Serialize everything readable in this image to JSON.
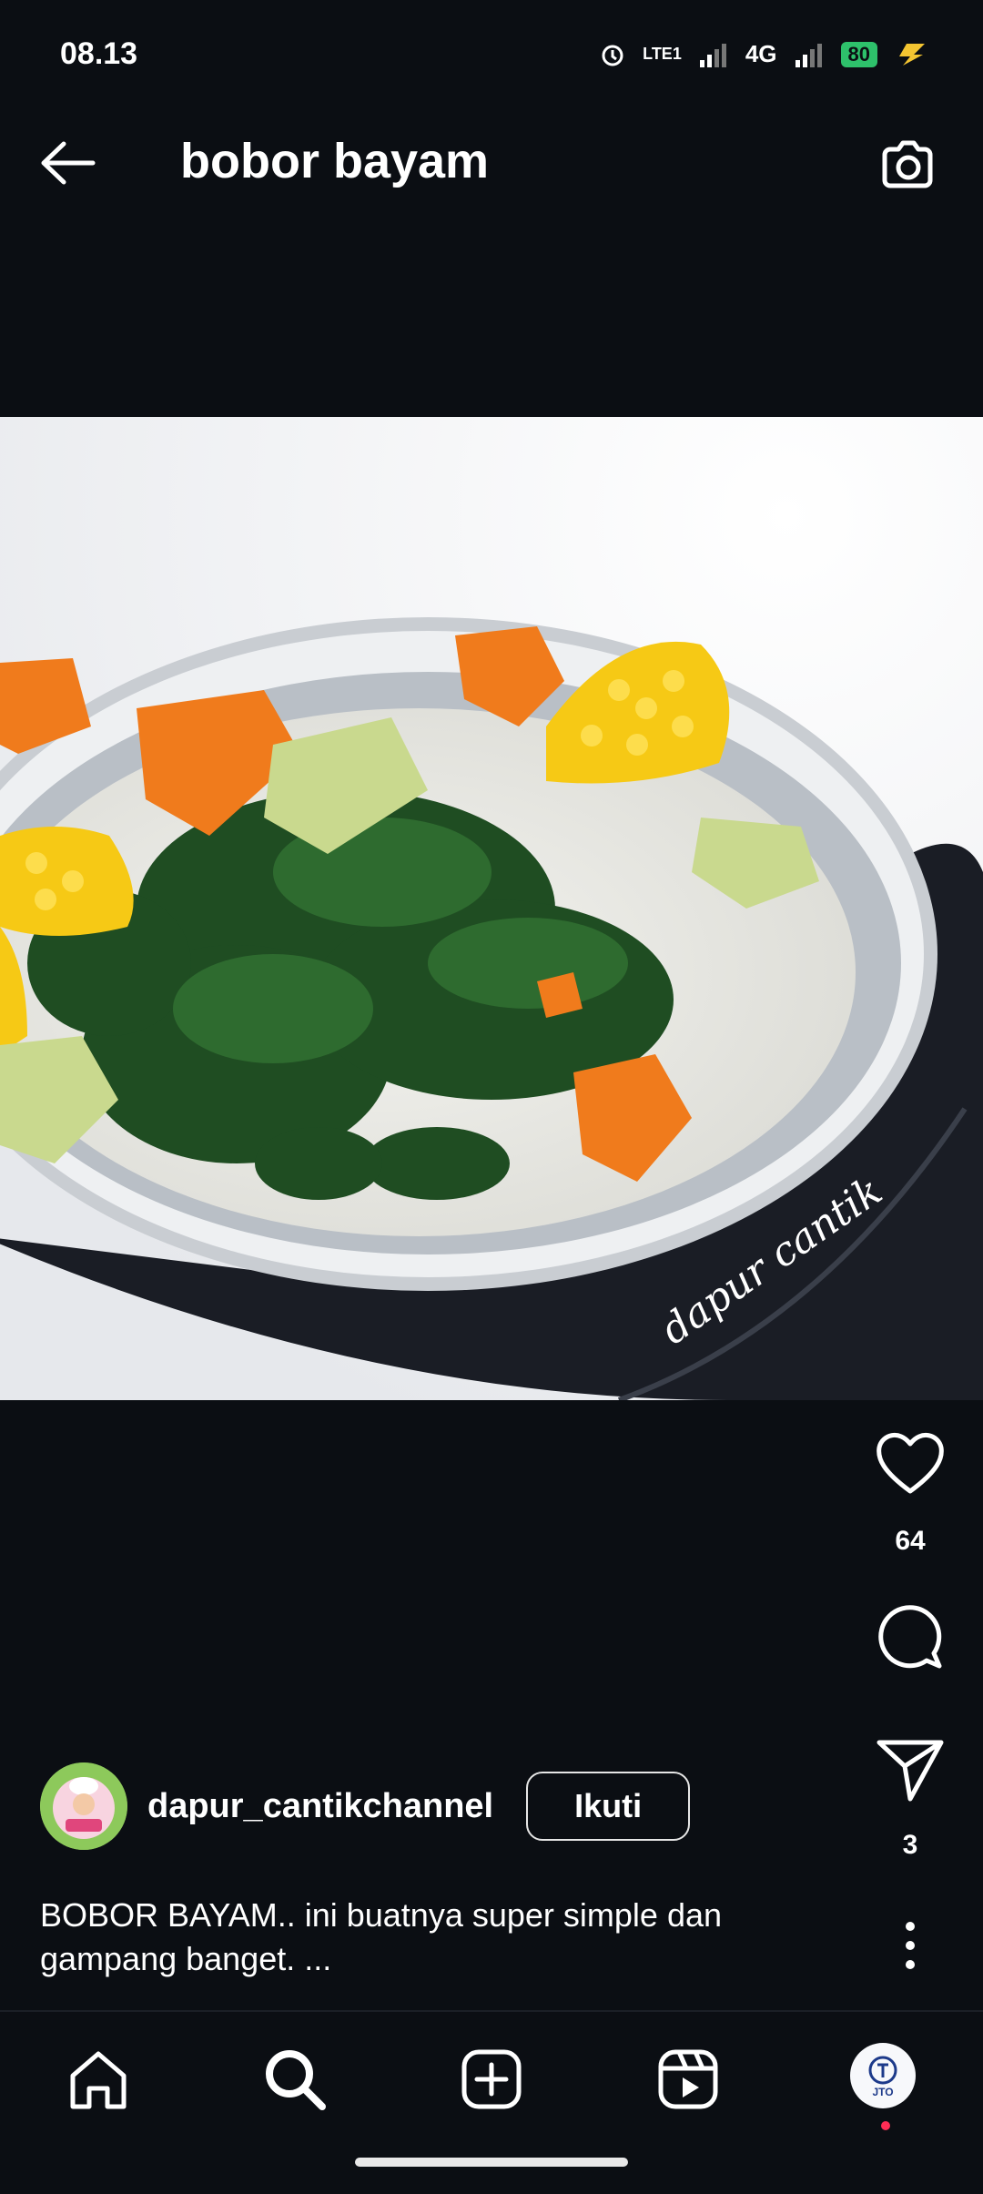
{
  "status_bar": {
    "time": "08.13",
    "network": "4G",
    "volte": "LTE1",
    "battery": "80"
  },
  "header": {
    "title": "bobor bayam"
  },
  "post": {
    "watermark": "dapur cantik",
    "likes": "64",
    "shares": "3",
    "author": "dapur_cantikchannel",
    "follow_label": "Ikuti",
    "caption_line1": "BOBOR BAYAM.. ini buatnya super simple dan",
    "caption_line2": "gampang banget. ..."
  },
  "nav": {
    "profile_label": "JTO"
  },
  "icons": [
    "back-arrow-icon",
    "camera-icon",
    "heart-icon",
    "comment-icon",
    "send-icon",
    "more-icon",
    "home-icon",
    "search-icon",
    "add-icon",
    "reels-icon"
  ],
  "colors": {
    "background": "#0b0e13",
    "battery": "#2ec16b",
    "notification_dot": "#ff2d55"
  }
}
